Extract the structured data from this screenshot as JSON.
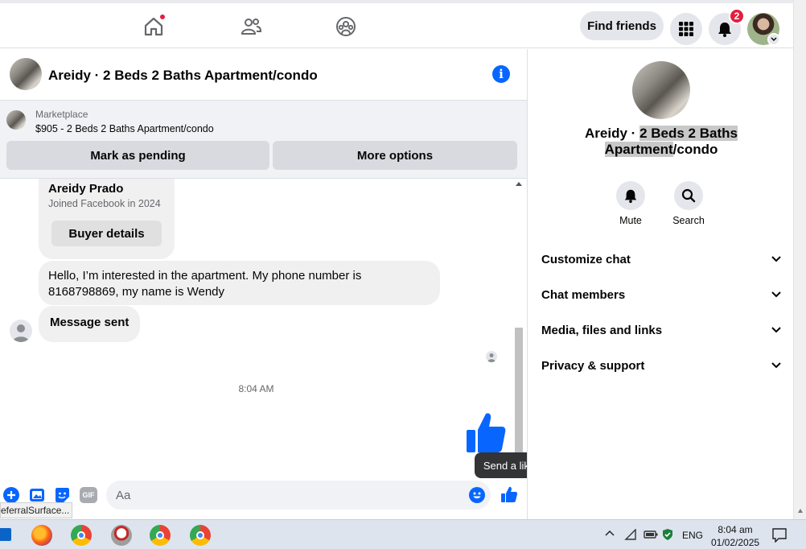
{
  "topbar": {
    "find_friends": "Find friends",
    "notification_count": "2",
    "icons": [
      "home-icon",
      "friends-icon",
      "groups-icon",
      "apps-grid-icon",
      "bell-icon",
      "profile-avatar"
    ]
  },
  "chat": {
    "title": "Areidy · 2 Beds 2 Baths Apartment/condo",
    "marketplace_label": "Marketplace",
    "marketplace_item": "$905 - 2 Beds 2 Baths Apartment/condo",
    "mark_pending": "Mark as pending",
    "more_options": "More options"
  },
  "messages": {
    "seller_name": "Areidy Prado",
    "seller_joined": "Joined Facebook in 2024",
    "buyer_details": "Buyer details",
    "message_text": "Hello, I’m interested in the apartment. My phone number is 8168798869, my name is Wendy",
    "status": "Message sent",
    "timestamp": "8:04 AM"
  },
  "composer": {
    "placeholder": "Aa",
    "tooltip": "Send a like",
    "status_url": "eferralSurface..."
  },
  "panel": {
    "title_plain_1": "Areidy · ",
    "title_highlight_1": "2 Beds 2 Baths",
    "title_highlight_2": "Apartment",
    "title_plain_2": "/condo",
    "mute": "Mute",
    "search": "Search",
    "sections": [
      "Customize chat",
      "Chat members",
      "Media, files and links",
      "Privacy & support"
    ]
  },
  "taskbar": {
    "language": "ENG",
    "time": "8:04 am",
    "date": "01/02/2025"
  },
  "colors": {
    "accent": "#0866ff",
    "badge": "#e41e3f",
    "bubble": "#f0f0f0"
  }
}
